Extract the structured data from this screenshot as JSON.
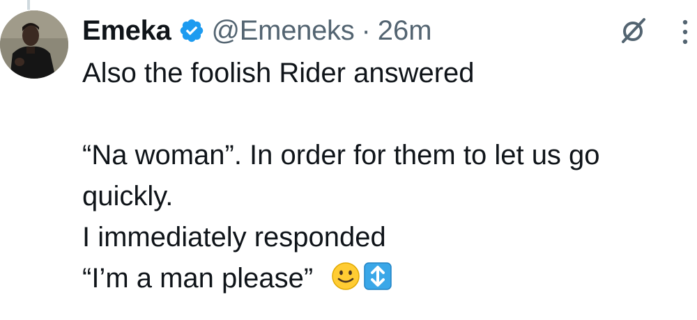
{
  "tweet": {
    "author_name": "Emeka",
    "handle": "@Emeneks",
    "separator": "·",
    "time": "26m",
    "lines": [
      "Also the foolish Rider answered",
      "“Na woman”. In order for them to let us go",
      "quickly.",
      "I immediately responded",
      "“I’m a man please”"
    ],
    "emojis": [
      "slightly-smiling-face",
      "up-down-arrow"
    ]
  },
  "icons": {
    "verified": "verified-badge-icon",
    "grok": "grok-icon",
    "more": "more-options-icon"
  },
  "colors": {
    "verified_blue": "#1d9bf0",
    "secondary_text": "#536471",
    "primary_text": "#0f1419",
    "thread_line": "#cfd9de"
  }
}
